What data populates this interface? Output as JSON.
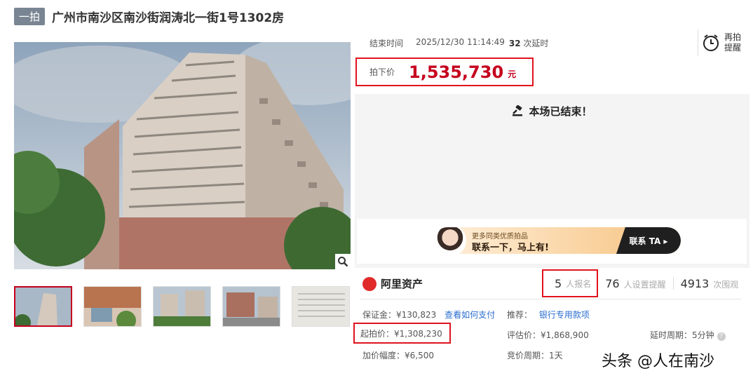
{
  "header": {
    "tag": "一拍",
    "title": "广州市南沙区南沙街润涛北一街1号1302房"
  },
  "auction": {
    "end_label": "结束时间",
    "end_time": "2025/12/30 11:14:49",
    "delay_count": "32",
    "delay_suffix": "次延时",
    "remind_label": "再拍提醒",
    "deal_label": "拍下价",
    "deal_price": "1,535,730",
    "deal_unit": "元",
    "ended_text": "本场已结束！"
  },
  "banner": {
    "line1": "更多同类优质拍品",
    "line2": "联系一下，马上有!",
    "cta": "联系 TA ▸"
  },
  "brand": {
    "name": "阿里资产"
  },
  "stats": [
    {
      "value": "5",
      "label": "人报名"
    },
    {
      "value": "76",
      "label": "人设置提醒"
    },
    {
      "value": "4913",
      "label": "次围观"
    }
  ],
  "details": {
    "deposit": "保证金：¥130,823",
    "deposit_link": "查看如何支付",
    "recommend": "推荐：",
    "recommend_link": "银行专用款项",
    "start_price": "起拍价：¥1,308,230",
    "eval_price": "评估价：¥1,868,900",
    "delay_period": "延时周期：5分钟",
    "increment": "加价幅度：¥6,500",
    "bid_period": "竞价周期：1天"
  },
  "watermark": "头条 @人在南沙",
  "colors": {
    "accent": "#c6001d",
    "link": "#2a6dcf",
    "tag_bg": "#7a8593"
  },
  "icons": [
    "gavel-icon",
    "alarm-clock-icon",
    "search-zoom-icon",
    "help-icon",
    "ali-logo-icon"
  ]
}
